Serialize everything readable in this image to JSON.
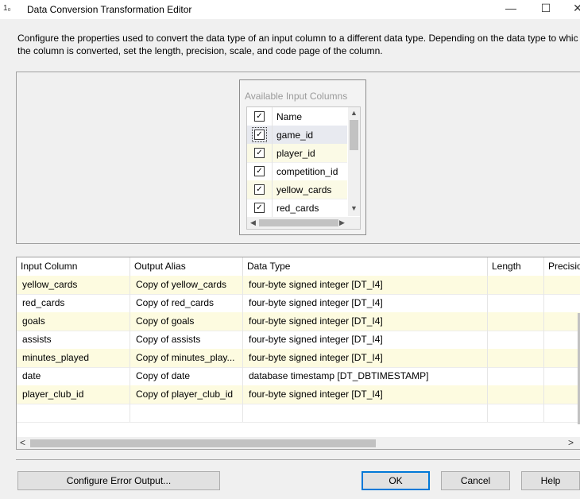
{
  "window": {
    "title": "Data Conversion Transformation Editor",
    "app_icon_text": "1₀",
    "controls": {
      "minimize": "—",
      "maximize": "☐",
      "close": "✕"
    }
  },
  "description": {
    "line1": "Configure the properties used to convert the data type of an input column to a different data type. Depending on the data type to whic",
    "line2": "the column is converted, set the length, precision, scale, and code page of the column."
  },
  "available_columns": {
    "title": "Available Input Columns",
    "header": "Name",
    "items": [
      {
        "label": "game_id"
      },
      {
        "label": "player_id"
      },
      {
        "label": "competition_id"
      },
      {
        "label": "yellow_cards"
      },
      {
        "label": "red_cards"
      }
    ],
    "check_glyph": "✓"
  },
  "grid": {
    "columns": [
      "Input Column",
      "Output Alias",
      "Data Type",
      "Length",
      "Precisio"
    ],
    "rows": [
      {
        "input": "yellow_cards",
        "alias": "Copy of yellow_cards",
        "type": "four-byte signed integer [DT_I4]"
      },
      {
        "input": "red_cards",
        "alias": "Copy of red_cards",
        "type": "four-byte signed integer [DT_I4]"
      },
      {
        "input": "goals",
        "alias": "Copy of goals",
        "type": "four-byte signed integer [DT_I4]"
      },
      {
        "input": "assists",
        "alias": "Copy of assists",
        "type": "four-byte signed integer [DT_I4]"
      },
      {
        "input": "minutes_played",
        "alias": "Copy of minutes_play...",
        "type": "four-byte signed integer [DT_I4]"
      },
      {
        "input": "date",
        "alias": "Copy of date",
        "type": "database timestamp [DT_DBTIMESTAMP]"
      },
      {
        "input": "player_club_id",
        "alias": "Copy of player_club_id",
        "type": "four-byte signed integer [DT_I4]"
      },
      {
        "input": "",
        "alias": "",
        "type": ""
      }
    ],
    "scroll_left": "<",
    "scroll_right": ">"
  },
  "buttons": {
    "error_output": "Configure Error Output...",
    "ok": "OK",
    "cancel": "Cancel",
    "help": "Help"
  }
}
